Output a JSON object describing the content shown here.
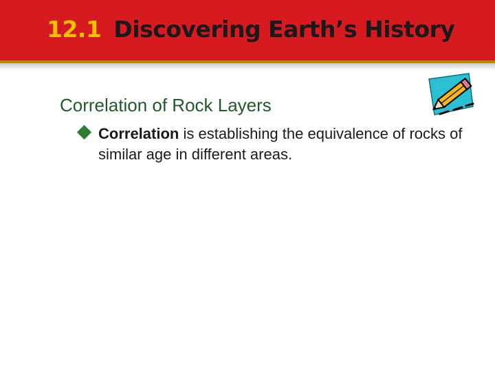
{
  "slide": {
    "title_number": "12.1",
    "title": "Discovering Earth’s History",
    "section_heading": "Correlation of Rock Layers",
    "bullet": {
      "term": "Correlation",
      "rest": " is establishing the equivalence of rocks of similar age in different areas."
    },
    "colors": {
      "title_bar": "#d71920",
      "title_number": "#f2c200",
      "heading": "#1f5a28",
      "bullet": "#2e7d32"
    },
    "icons": {
      "decoration": "pencil-icon",
      "bullet": "diamond-bullet-icon"
    }
  }
}
